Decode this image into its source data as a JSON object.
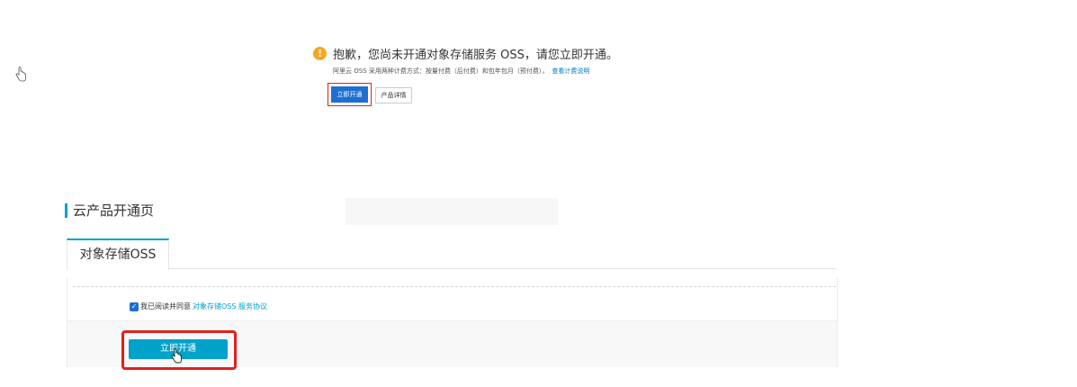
{
  "notice": {
    "title": "抱歉，您尚未开通对象存储服务 OSS，请您立即开通。",
    "description": "阿里云 OSS 采用两种计费方式：按量付费（后付费）和包年包月（预付费），",
    "billing_link": "查看计费说明",
    "open_button": "立即开通",
    "detail_button": "产品详情"
  },
  "page": {
    "section_title": "云产品开通页"
  },
  "tabs": [
    {
      "label": "对象存储OSS"
    }
  ],
  "agreement": {
    "checked": true,
    "text": "我已阅读并同意",
    "link": "对象存储OSS 服务协议"
  },
  "activate_button": "立即开通",
  "colors": {
    "primary_blue": "#1e6fd0",
    "accent_teal": "#00a2ca",
    "highlight_red": "#e02020",
    "warning_orange": "#f5a623"
  },
  "icons": [
    "hand-cursor-icon",
    "warning-icon",
    "checkbox-checked-icon"
  ]
}
